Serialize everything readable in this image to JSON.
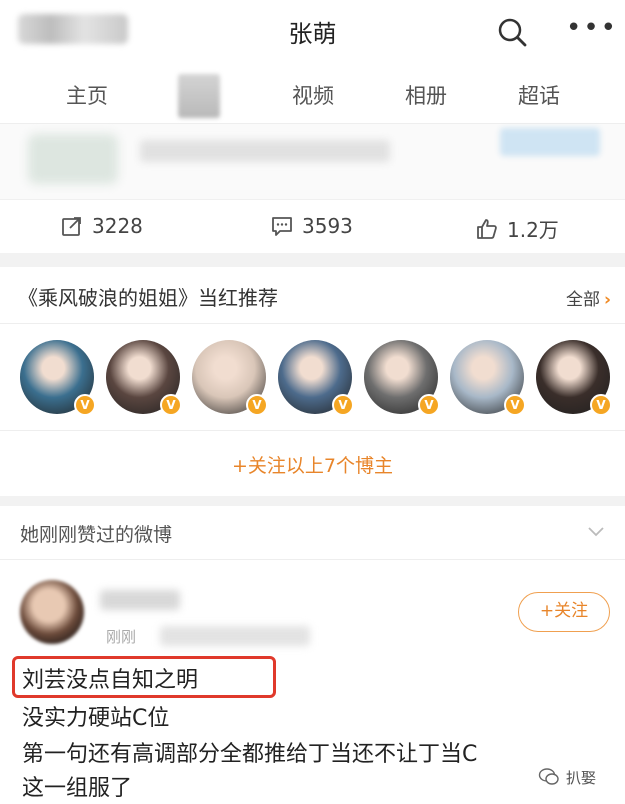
{
  "header": {
    "title": "张萌"
  },
  "tabs": [
    {
      "label": "主页"
    },
    {
      "label": "视频"
    },
    {
      "label": "相册"
    },
    {
      "label": "超话"
    }
  ],
  "stats": {
    "reposts": "3228",
    "comments": "3593",
    "likes": "1.2万"
  },
  "recommend": {
    "title": "《乘风破浪的姐姐》当红推荐",
    "all_label": "全部",
    "avatars": [
      {
        "name": "avatar-1",
        "color": "#3b6f8f"
      },
      {
        "name": "avatar-2",
        "color": "#5a4640"
      },
      {
        "name": "avatar-3",
        "color": "#d9c6b8"
      },
      {
        "name": "avatar-4",
        "color": "#4d6b8c"
      },
      {
        "name": "avatar-5",
        "color": "#6e6e6e"
      },
      {
        "name": "avatar-6",
        "color": "#a8b8c8"
      },
      {
        "name": "avatar-7",
        "color": "#3a2e2a"
      }
    ],
    "badge": "V",
    "follow_all_label": "+关注以上7个博主"
  },
  "liked": {
    "title": "她刚刚赞过的微博"
  },
  "post": {
    "time": "刚刚",
    "follow_label": "+关注",
    "lines": [
      "刘芸没点自知之明",
      "没实力硬站C位",
      "第一句还有高调部分全都推给丁当还不让丁当C",
      "这一组服了"
    ]
  },
  "watermark": {
    "text": "扒娶"
  }
}
